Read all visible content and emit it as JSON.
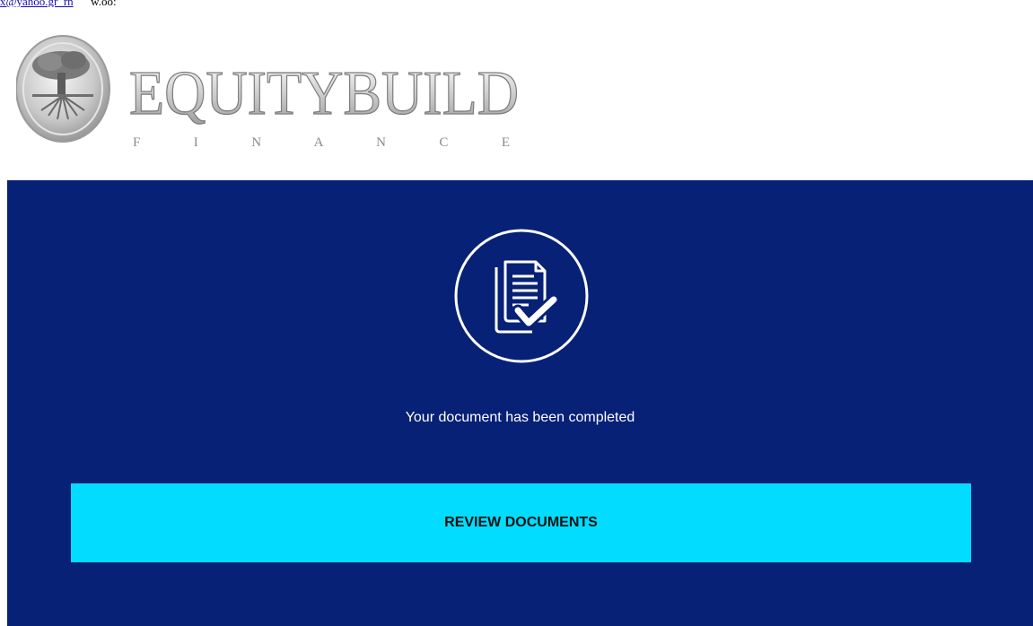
{
  "header": {
    "top_link_text": "x@yahoo.gr_rn",
    "top_suffix": "      w.oo:"
  },
  "logo": {
    "name": "EQUITYBUILD",
    "subtitle": "F I N A N C E",
    "icon": "tree-seal-icon"
  },
  "panel": {
    "icon": "document-check-icon",
    "status_text": "Your document has been completed",
    "button_label": "REVIEW DOCUMENTS"
  },
  "colors": {
    "panel_bg": "#062175",
    "button_bg": "#02dcfe",
    "text_on_panel": "#ffffff"
  }
}
